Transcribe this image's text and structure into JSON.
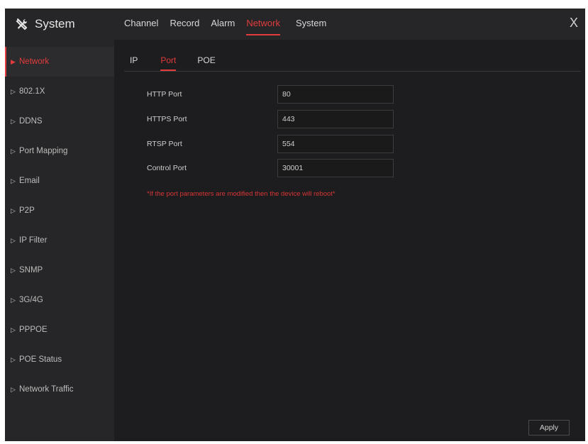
{
  "header": {
    "title": "System",
    "logo_icon": "tools-icon",
    "tabs": [
      {
        "label": "Channel",
        "active": false
      },
      {
        "label": "Record",
        "active": false
      },
      {
        "label": "Alarm",
        "active": false
      },
      {
        "label": "Network",
        "active": true
      },
      {
        "label": "System",
        "active": false
      }
    ],
    "close_label": "X"
  },
  "sidebar": {
    "items": [
      {
        "label": "Network",
        "active": true
      },
      {
        "label": "802.1X",
        "active": false
      },
      {
        "label": "DDNS",
        "active": false
      },
      {
        "label": "Port Mapping",
        "active": false
      },
      {
        "label": "Email",
        "active": false
      },
      {
        "label": "P2P",
        "active": false
      },
      {
        "label": "IP Filter",
        "active": false
      },
      {
        "label": "SNMP",
        "active": false
      },
      {
        "label": "3G/4G",
        "active": false
      },
      {
        "label": "PPPOE",
        "active": false
      },
      {
        "label": "POE Status",
        "active": false
      },
      {
        "label": "Network Traffic",
        "active": false
      }
    ]
  },
  "sub_tabs": [
    {
      "label": "IP",
      "active": false
    },
    {
      "label": "Port",
      "active": true
    },
    {
      "label": "POE",
      "active": false
    }
  ],
  "form": {
    "fields": [
      {
        "label": "HTTP Port",
        "value": "80"
      },
      {
        "label": "HTTPS Port",
        "value": "443"
      },
      {
        "label": "RTSP Port",
        "value": "554"
      },
      {
        "label": "Control Port",
        "value": "30001"
      }
    ],
    "note": "*If the port parameters are modified then the device will reboot*"
  },
  "actions": {
    "apply_label": "Apply"
  },
  "colors": {
    "accent": "#e23b3b",
    "background": "#1d1d1f",
    "panel": "#262628"
  }
}
